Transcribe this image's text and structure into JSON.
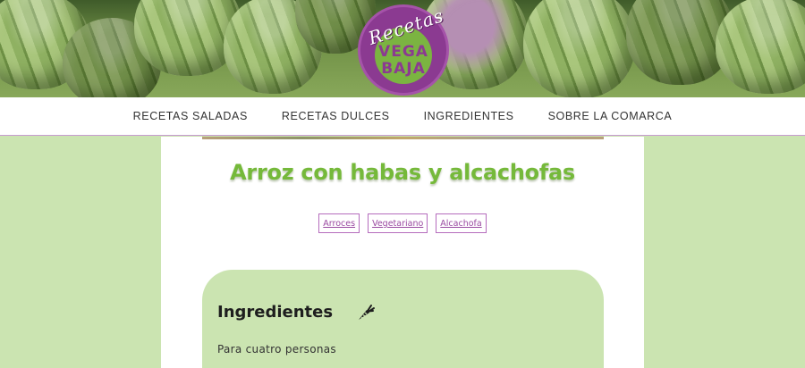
{
  "logo": {
    "script": "Recetas",
    "line1": "VEGA",
    "line2": "BAJA"
  },
  "nav": {
    "items": [
      {
        "label": "RECETAS SALADAS"
      },
      {
        "label": "RECETAS DULCES"
      },
      {
        "label": "INGREDIENTES"
      },
      {
        "label": "SOBRE LA COMARCA"
      }
    ]
  },
  "recipe": {
    "title": "Arroz con habas y alcachofas",
    "tags": [
      "Arroces",
      "Vegetariano",
      "Alcachofa"
    ]
  },
  "ingredients": {
    "heading": "Ingredientes",
    "icon": "carrot-icon",
    "servings": "Para cuatro personas"
  },
  "colors": {
    "brand_purple": "#8b3a91",
    "brand_green": "#75b93a",
    "page_background": "#cbe4b1"
  }
}
